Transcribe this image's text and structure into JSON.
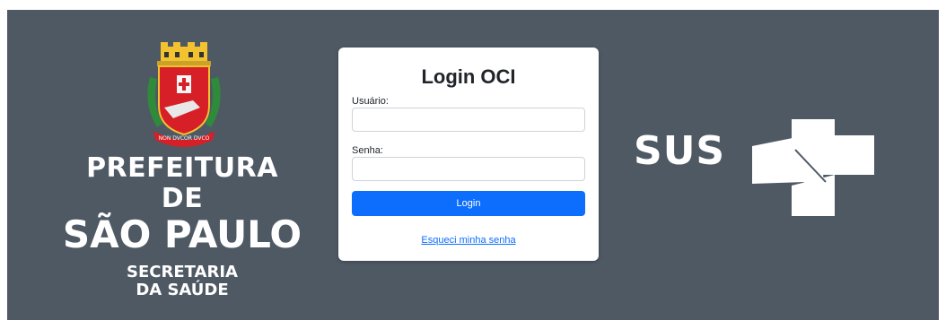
{
  "brand": {
    "motto": "NON DVCOR DVCO",
    "line1": "PREFEITURA DE",
    "line2": "SÃO PAULO",
    "line3": "SECRETARIA",
    "line4": "DA SAÚDE"
  },
  "login": {
    "title": "Login OCI",
    "username_label": "Usuário:",
    "username_value": "",
    "password_label": "Senha:",
    "password_value": "",
    "submit_label": "Login",
    "forgot_label": "Esqueci minha senha"
  },
  "sus": {
    "text": "SUS"
  },
  "colors": {
    "background": "#4f5964",
    "primary": "#0d6efd",
    "card": "#ffffff"
  }
}
